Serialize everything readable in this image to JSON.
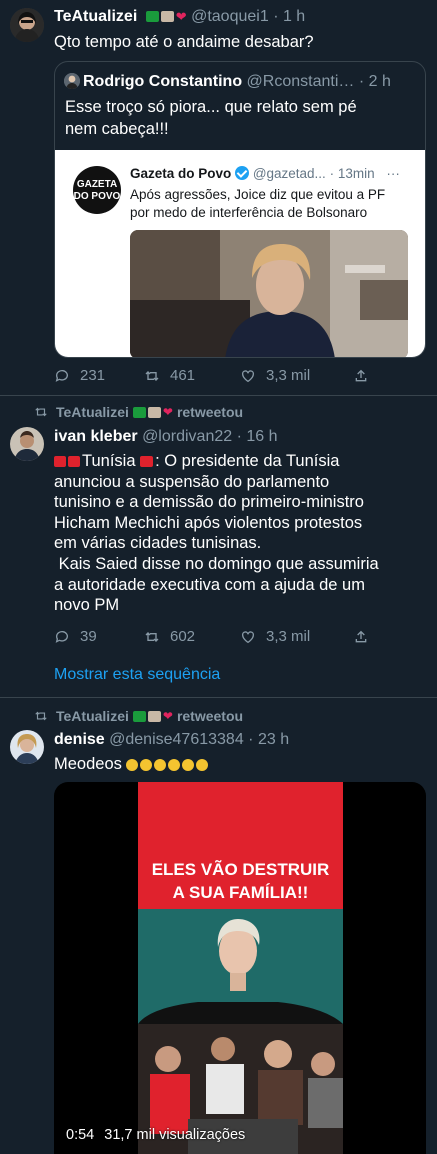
{
  "tweet1": {
    "display_name": "TeAtualizei",
    "handle": "@taoquei1",
    "time": "· 1 h",
    "text": "Qto tempo até o andaime desabar?",
    "quote": {
      "display_name": "Rodrigo Constantino",
      "handle": "@Rconstanti…",
      "time": "· 2 h",
      "text_line1": "Esse troço só piora... que relato sem pé",
      "text_line2": "nem cabeça!!!",
      "card": {
        "logo_line1": "GAZETA",
        "logo_line2": "DO POVO",
        "source_name": "Gazeta do Povo",
        "source_handle": "@gazetad...",
        "source_time": "· 13min",
        "more": "···",
        "text_line1": "Após agressões, Joice diz que evitou a PF",
        "text_line2": "por medo de interferência de Bolsonaro"
      }
    },
    "actions": {
      "replies": "231",
      "retweets": "461",
      "likes": "3,3 mil"
    }
  },
  "tweet2": {
    "retweeted_by": "TeAtualizei",
    "retweet_label": "retweetou",
    "display_name": "ivan kleber",
    "handle": "@lordivan22",
    "time": "· 16 h",
    "text_line1": "Tunísia",
    "text_line1_rest": ": O presidente da Tunísia",
    "text_line2": "anunciou a suspensão do parlamento",
    "text_line3": "tunisino e a demissão do primeiro-ministro",
    "text_line4": "Hicham Mechichi após violentos protestos",
    "text_line5": "em várias cidades tunisinas.",
    "text_line6": " Kais Saied disse no domingo que assumiria",
    "text_line7": "a autoridade executiva com a ajuda de um",
    "text_line8": "novo PM",
    "actions": {
      "replies": "39",
      "retweets": "602",
      "likes": "3,3 mil"
    },
    "show_thread": "Mostrar esta sequência"
  },
  "tweet3": {
    "retweeted_by": "TeAtualizei",
    "retweet_label": "retweetou",
    "display_name": "denise",
    "handle": "@denise47613384",
    "time": "· 23 h",
    "text": "Meodeos",
    "video": {
      "headline_line1": "ELES VÃO DESTRUIR",
      "headline_line2": "A SUA FAMÍLIA!!",
      "duration": "0:54",
      "views": "31,7 mil visualizações"
    }
  },
  "colors": {
    "background": "#15202b",
    "border": "#38444d",
    "muted": "#8899a6",
    "link": "#1da1f2",
    "video_red": "#e0222d",
    "video_teal": "#1f6b68"
  }
}
